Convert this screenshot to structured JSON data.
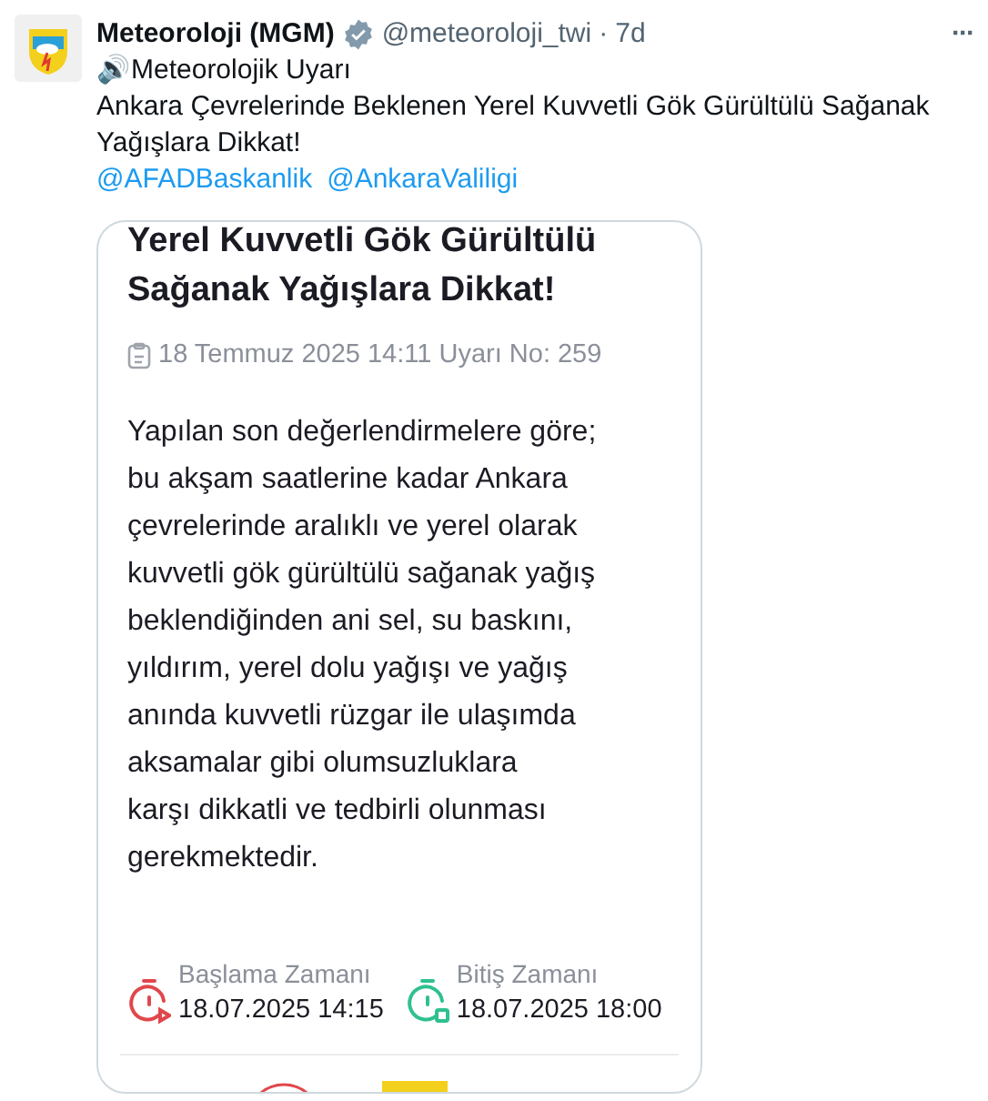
{
  "tweet": {
    "author": "Meteoroloji (MGM)",
    "verified": true,
    "handle": "@meteoroloji_twi",
    "separator": "·",
    "time": "7d",
    "more": "···",
    "text_lines": [
      "🔊Meteorolojik Uyarı",
      "Ankara Çevrelerinde Beklenen Yerel Kuvvetli Gök Gürültülü Sağanak",
      "Yağışlara Dikkat!"
    ],
    "mentions": [
      "@AFADBaskanlik",
      "@AnkaraValiligi"
    ]
  },
  "card": {
    "title_lines": [
      "Yerel Kuvvetli Gök Gürültülü",
      "Sağanak Yağışlara Dikkat!"
    ],
    "meta": "18 Temmuz 2025 14:11 Uyarı No: 259",
    "body_lines": [
      "Yapılan son değerlendirmelere göre;",
      "bu akşam saatlerine kadar Ankara",
      "çevrelerinde aralıklı ve yerel olarak",
      "kuvvetli gök gürültülü sağanak yağış",
      "beklendiğinden ani sel, su baskını,",
      "yıldırım, yerel dolu yağışı ve yağış",
      "anında kuvvetli rüzgar ile ulaşımda",
      "aksamalar gibi olumsuzluklara",
      "karşı dikkatli ve tedbirli olunması",
      "gerekmektedir."
    ],
    "times": [
      {
        "kind": "start",
        "label": "Başlama Zamanı",
        "value": "18.07.2025 14:15",
        "color": "#e0474c"
      },
      {
        "kind": "end",
        "label": "Bitiş Zamanı",
        "value": "18.07.2025 18:00",
        "color": "#2fc08f"
      }
    ]
  }
}
